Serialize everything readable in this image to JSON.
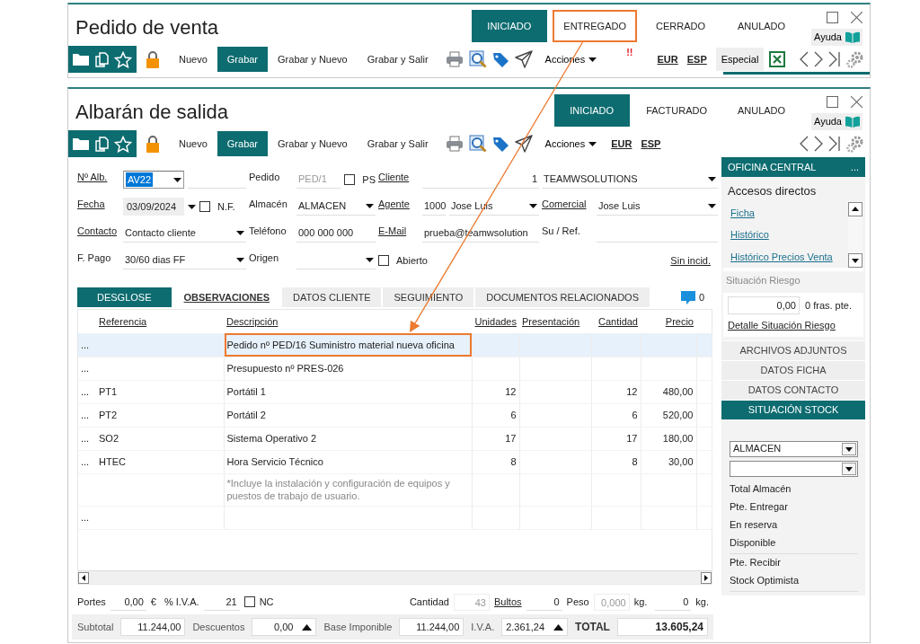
{
  "windows": [
    {
      "title": "Pedido de venta",
      "states": [
        {
          "label": "INICIADO",
          "selected": true,
          "highlighted": false
        },
        {
          "label": "ENTREGADO",
          "selected": false,
          "highlighted": true
        },
        {
          "label": "CERRADO",
          "selected": false,
          "highlighted": false
        },
        {
          "label": "ANULADO",
          "selected": false,
          "highlighted": false
        }
      ],
      "help": "Ayuda",
      "toolbar": {
        "actions": [
          {
            "label": "Nuevo",
            "selected": false
          },
          {
            "label": "Grabar",
            "selected": true
          },
          {
            "label": "Grabar y Nuevo",
            "selected": false
          },
          {
            "label": "Grabar y Salir",
            "selected": false
          }
        ],
        "options": [
          {
            "kind": "menu",
            "label": "Acciones"
          },
          {
            "kind": "alert",
            "label": "!!"
          },
          {
            "kind": "link",
            "label": "EUR"
          },
          {
            "kind": "link",
            "label": "ESP"
          },
          {
            "kind": "chip",
            "label": "Especial"
          }
        ],
        "excel": true
      }
    },
    {
      "title": "Albarán de salida",
      "states": [
        {
          "label": "INICIADO",
          "selected": true,
          "highlighted": false
        },
        {
          "label": "FACTURADO",
          "selected": false,
          "highlighted": false
        },
        {
          "label": "ANULADO",
          "selected": false,
          "highlighted": false
        }
      ],
      "help": "Ayuda",
      "toolbar": {
        "actions": [
          {
            "label": "Nuevo",
            "selected": false
          },
          {
            "label": "Grabar",
            "selected": true
          },
          {
            "label": "Grabar y Nuevo",
            "selected": false
          },
          {
            "label": "Grabar y Salir",
            "selected": false
          }
        ],
        "options": [
          {
            "kind": "menu",
            "label": "Acciones"
          },
          {
            "kind": "link",
            "label": "EUR"
          },
          {
            "kind": "link",
            "label": "ESP"
          }
        ]
      }
    }
  ],
  "form": [
    [
      {
        "label": "Nº Alb.",
        "link": true,
        "controls": [
          {
            "kind": "select",
            "value": "AV22",
            "focused": true
          }
        ]
      },
      {
        "label": "Pedido",
        "link": false,
        "controls": [
          {
            "kind": "input",
            "value": "PED/1",
            "disabled": true
          },
          {
            "kind": "checkbox",
            "label": "PS",
            "checked": false
          }
        ]
      },
      {
        "label": "Cliente",
        "link": true,
        "controls": [
          {
            "kind": "number",
            "value": "1"
          }
        ]
      },
      {
        "controls": [
          {
            "kind": "select",
            "value": "TEAMWSOLUTIONS"
          }
        ]
      }
    ],
    [
      {
        "label": "Fecha",
        "link": true,
        "controls": [
          {
            "kind": "date",
            "value": "03/09/2024"
          },
          {
            "kind": "checkbox",
            "label": "N.F.",
            "checked": false
          }
        ]
      },
      {
        "label": "Almacén",
        "link": false,
        "controls": [
          {
            "kind": "select",
            "value": "ALMACEN"
          }
        ]
      },
      {
        "label": "Agente",
        "link": true,
        "controls": [
          {
            "kind": "input",
            "value": "1000"
          },
          {
            "kind": "select",
            "value": "Jose Luis"
          }
        ]
      },
      {
        "label": "Comercial",
        "link": true,
        "controls": [
          {
            "kind": "select",
            "value": "Jose Luis"
          }
        ]
      }
    ],
    [
      {
        "label": "Contacto",
        "link": true,
        "controls": [
          {
            "kind": "select",
            "value": "Contacto cliente"
          }
        ]
      },
      {
        "label": "Teléfono",
        "link": false,
        "controls": [
          {
            "kind": "input",
            "value": "000 000 000"
          }
        ]
      },
      {
        "label": "E-Mail",
        "link": true,
        "controls": [
          {
            "kind": "input",
            "value": "prueba@teamwsolution"
          }
        ]
      },
      {
        "label": "Su / Ref.",
        "link": false,
        "controls": [
          {
            "kind": "input"
          }
        ]
      }
    ],
    [
      {
        "label": "F. Pago",
        "link": false,
        "controls": [
          {
            "kind": "select",
            "value": "30/60 dias FF"
          }
        ]
      },
      {
        "label": "Origen",
        "link": false,
        "controls": [
          {
            "kind": "select"
          }
        ]
      },
      {
        "controls": [
          {
            "kind": "checkbox",
            "label": "Abierto",
            "checked": false
          }
        ]
      },
      {
        "controls": [
          {
            "kind": "link",
            "label": "Sin incid."
          }
        ]
      }
    ]
  ],
  "tabs": [
    {
      "label": "DESGLOSE",
      "selected": true,
      "has_content": false
    },
    {
      "label": "OBSERVACIONES",
      "selected": false,
      "has_content": true
    },
    {
      "label": "DATOS CLIENTE",
      "selected": false,
      "has_content": false
    },
    {
      "label": "SEGUIMIENTO",
      "selected": false,
      "has_content": false
    },
    {
      "label": "DOCUMENTOS RELACIONADOS",
      "selected": false,
      "has_content": false
    }
  ],
  "comments": "0",
  "table": {
    "columns": [
      "Referencia",
      "Descripción",
      "Unidades",
      "Presentación",
      "Cantidad",
      "Precio"
    ],
    "rows": [
      {
        "kind": "line",
        "handle": "...",
        "cells": [
          null,
          "Pedido nº PED/16 Suministro material nueva oficina",
          null,
          null,
          null,
          null
        ],
        "selected": true,
        "highlighted": true
      },
      {
        "kind": "line",
        "handle": "...",
        "cells": [
          null,
          "Presupuesto nº PRES-026",
          null,
          null,
          null,
          null
        ],
        "selected": false
      },
      {
        "kind": "line",
        "handle": "...",
        "cells": [
          "PT1",
          "Portátil 1",
          "12",
          null,
          "12",
          "480,00"
        ],
        "selected": false
      },
      {
        "kind": "line",
        "handle": "...",
        "cells": [
          "PT2",
          "Portátil 2",
          "6",
          null,
          "6",
          "520,00"
        ],
        "selected": false
      },
      {
        "kind": "line",
        "handle": "...",
        "cells": [
          "SO2",
          "Sistema Operativo 2",
          "17",
          null,
          "17",
          "180,00"
        ],
        "selected": false
      },
      {
        "kind": "line",
        "handle": "...",
        "cells": [
          "HTEC",
          "Hora Servicio Técnico",
          "8",
          null,
          "8",
          "30,00"
        ],
        "selected": false
      },
      {
        "kind": "note",
        "text": "*Incluye la instalación y configuración de equipos y puestos de trabajo de usuario.",
        "selected": false
      },
      {
        "kind": "blank",
        "handle": "...",
        "selected": false
      }
    ]
  },
  "footer": {
    "left": [
      {
        "kind": "label",
        "text": "Portes"
      },
      {
        "kind": "field",
        "value": "0,00"
      },
      {
        "kind": "unit",
        "text": "€"
      },
      {
        "kind": "label",
        "text": "% I.V.A."
      },
      {
        "kind": "field",
        "value": "21"
      },
      {
        "kind": "checkbox",
        "label": "NC",
        "checked": false
      }
    ],
    "right": [
      {
        "kind": "label",
        "text": "Cantidad"
      },
      {
        "kind": "field",
        "value": "43",
        "disabled": true
      },
      {
        "kind": "link",
        "text": "Bultos"
      },
      {
        "kind": "field",
        "value": "0"
      },
      {
        "kind": "label",
        "text": "Peso"
      },
      {
        "kind": "field",
        "value": "0,000",
        "disabled": true
      },
      {
        "kind": "unit",
        "text": "kg."
      },
      {
        "kind": "field",
        "value": "0"
      },
      {
        "kind": "unit",
        "text": "kg."
      }
    ]
  },
  "totals": [
    {
      "label": "Subtotal",
      "value": "11.244,00",
      "spinner": false,
      "strong": false
    },
    {
      "label": "Descuentos",
      "value": "0,00",
      "spinner": true,
      "strong": false
    },
    {
      "label": "Base Imponible",
      "value": "11.244,00",
      "spinner": false,
      "strong": false
    },
    {
      "label": "I.V.A.",
      "value": "2.361,24",
      "spinner": true,
      "strong": false
    },
    {
      "label": "TOTAL",
      "value": "13.605,24",
      "spinner": false,
      "strong": true
    }
  ],
  "side": {
    "header": "OFICINA CENTRAL",
    "header_menu": "...",
    "shortcuts_title": "Accesos directos",
    "shortcuts": [
      "Ficha",
      "Histórico",
      "Histórico Precios Venta"
    ],
    "risk": {
      "title": "Situación Riesgo",
      "amount": "0,00",
      "pending": "0 fras. pte.",
      "detail": "Detalle Situación Riesgo"
    },
    "sections": [
      {
        "label": "ARCHIVOS ADJUNTOS",
        "selected": false
      },
      {
        "label": "DATOS FICHA",
        "selected": false
      },
      {
        "label": "DATOS CONTACTO",
        "selected": false
      },
      {
        "label": "SITUACIÓN STOCK",
        "selected": true
      }
    ],
    "stock": {
      "selects": [
        {
          "kind": "filled",
          "value": "ALMACEN"
        },
        {
          "kind": "blank"
        }
      ],
      "groups": [
        [
          "Total Almacén",
          "Pte. Entregar",
          "En reserva",
          "Disponible"
        ],
        [
          "Pte. Recibir",
          "Stock Optimista"
        ]
      ]
    }
  }
}
